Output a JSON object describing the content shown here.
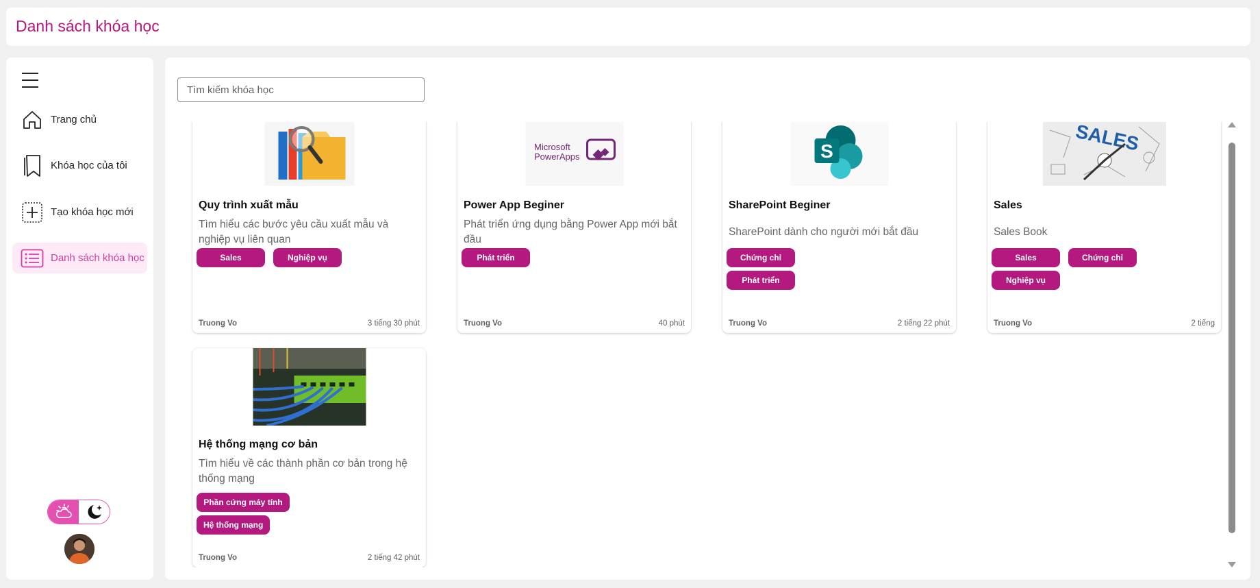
{
  "header": {
    "title": "Danh sách khóa học"
  },
  "sidebar": {
    "items": [
      {
        "label": "Trang chủ",
        "icon": "home-icon"
      },
      {
        "label": "Khóa học của tôi",
        "icon": "bookmark-icon"
      },
      {
        "label": "Tạo khóa học mới",
        "icon": "add-icon"
      },
      {
        "label": "Danh sách khóa học",
        "icon": "list-icon",
        "active": true
      }
    ],
    "theme": {
      "light": "weather-sun-icon",
      "dark": "moon-sparkle-icon"
    }
  },
  "search": {
    "placeholder": "Tìm kiếm khóa học",
    "value": ""
  },
  "courses": [
    {
      "title": "Quy trình xuất mẫu",
      "description": "Tìm hiểu các bước yêu cầu xuất mẫu và nghiệp vụ liên quan",
      "tags": [
        "Sales",
        "Nghiệp vụ"
      ],
      "author": "Truong Vo",
      "duration": "3 tiếng 30 phút"
    },
    {
      "title": "Power App Beginer",
      "description": "Phát triển ứng dụng bằng Power App mới bắt đầu",
      "tags": [
        "Phát triển"
      ],
      "author": "Truong Vo",
      "duration": "40 phút",
      "logo_text": [
        "Microsoft",
        "PowerApps"
      ]
    },
    {
      "title": "SharePoint Beginer",
      "description": "SharePoint dành cho người mới bắt đầu",
      "tags": [
        "Chứng chỉ",
        "Phát triển"
      ],
      "author": "Truong Vo",
      "duration": "2 tiếng 22 phút"
    },
    {
      "title": "Sales",
      "description": "Sales Book",
      "tags": [
        "Sales",
        "Chứng chỉ",
        "Nghiệp vụ"
      ],
      "author": "Truong Vo",
      "duration": "2 tiếng",
      "image_text": "SALES"
    },
    {
      "title": "Hệ thống mạng cơ bản",
      "description": "Tìm hiểu về các thành phần cơ bản trong hệ thống mạng",
      "tags": [
        "Phần cứng máy tính",
        "Hệ thống mạng"
      ],
      "author": "Truong Vo",
      "duration": "2 tiếng 42 phút"
    }
  ],
  "colors": {
    "brand": "#b4187f",
    "tag": "#b3197f",
    "active_bg": "#fdeaf6",
    "toggle": "#e54fb0"
  }
}
